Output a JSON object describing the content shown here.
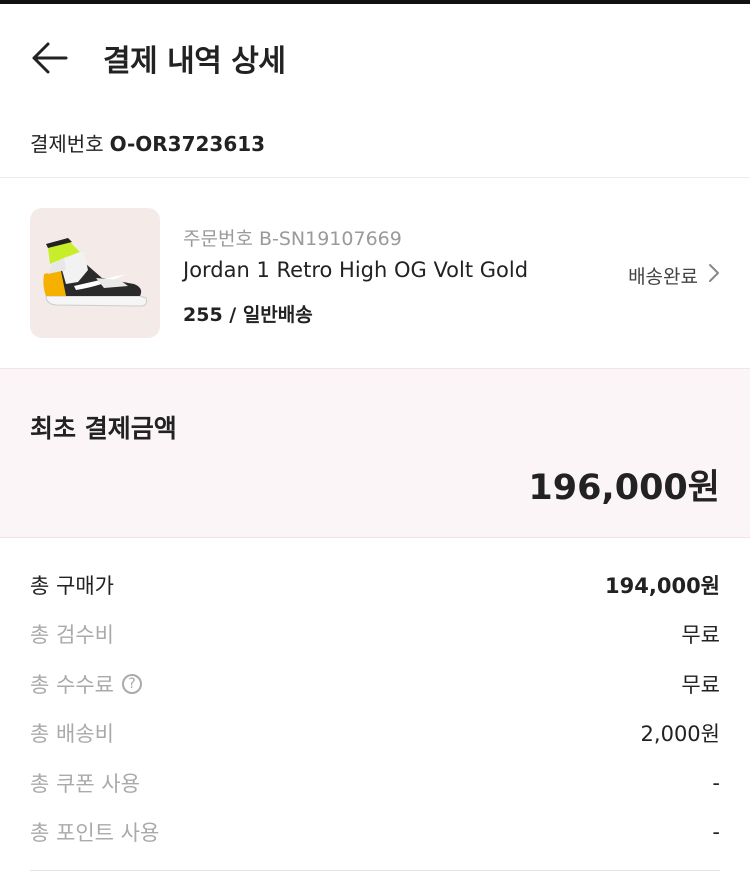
{
  "header": {
    "title": "결제 내역 상세",
    "back_icon": "arrow-left-icon"
  },
  "payment": {
    "label": "결제번호",
    "number": "O-OR3723613"
  },
  "order": {
    "order_no_label": "주문번호",
    "order_no": "B-SN19107669",
    "product_name": "Jordan 1 Retro High OG Volt Gold",
    "option": "255 / 일반배송",
    "status": "배송완료",
    "status_icon": "chevron-right-icon",
    "thumbnail_icon": "sneaker-icon",
    "thumbnail_bg": "#f4ebe9"
  },
  "total": {
    "label": "최초 결제금액",
    "amount": "196,000원",
    "bg_color": "#fcf5f8"
  },
  "breakdown": [
    {
      "label": "총 구매가",
      "value": "194,000원"
    },
    {
      "label": "총 검수비",
      "value": "무료"
    },
    {
      "label": "총 수수료",
      "value": "무료",
      "help_icon": "?"
    },
    {
      "label": "총 배송비",
      "value": "2,000원"
    },
    {
      "label": "총 쿠폰 사용",
      "value": "-"
    },
    {
      "label": "총 포인트 사용",
      "value": "-"
    }
  ]
}
